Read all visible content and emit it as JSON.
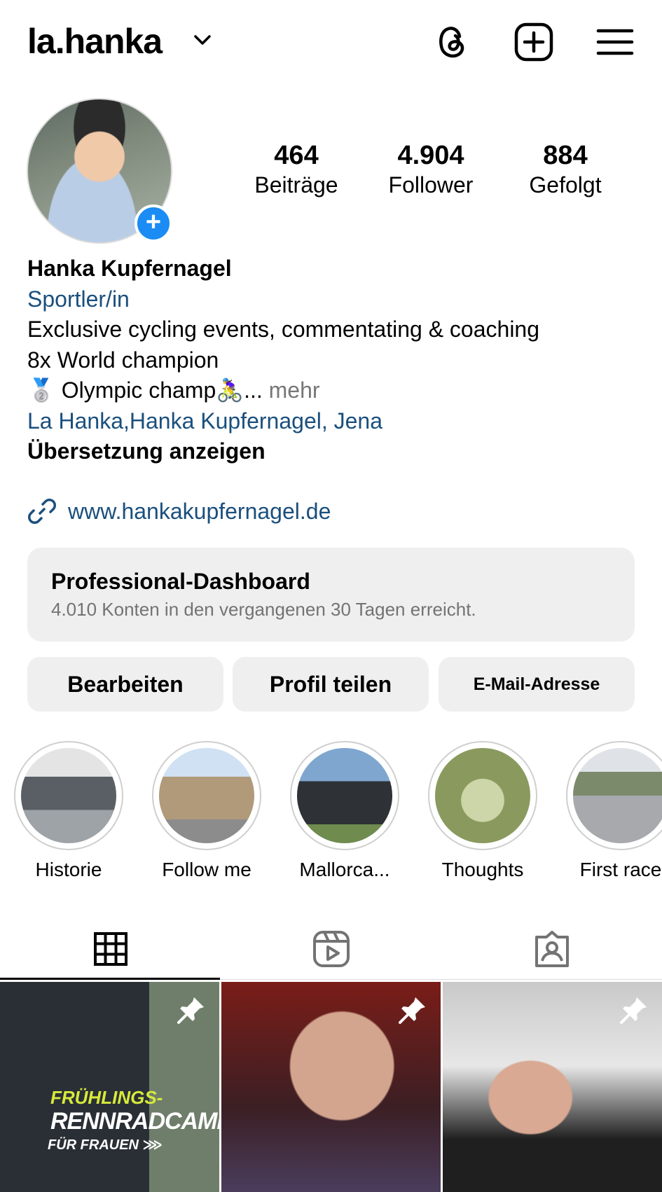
{
  "header": {
    "username": "la.hanka"
  },
  "stats": [
    {
      "value": "464",
      "label": "Beiträge"
    },
    {
      "value": "4.904",
      "label": "Follower"
    },
    {
      "value": "884",
      "label": "Gefolgt"
    }
  ],
  "bio": {
    "name": "Hanka Kupfernagel",
    "category": "Sportler/in",
    "line1": "Exclusive cycling events, commentating & coaching",
    "line2": "8x World champion",
    "line3": "🥈 Olympic champ🚴‍♀️...",
    "more": "mehr",
    "location": "La Hanka,Hanka Kupfernagel, Jena",
    "translate": "Übersetzung anzeigen",
    "website": "www.hankakupfernagel.de"
  },
  "dashboard": {
    "title": "Professional-Dashboard",
    "subtitle": "4.010 Konten in den vergangenen 30 Tagen erreicht."
  },
  "buttons": {
    "edit": "Bearbeiten",
    "share": "Profil teilen",
    "email": "E-Mail-Adresse"
  },
  "highlights": [
    {
      "label": "Historie",
      "color": "#8a8f96"
    },
    {
      "label": "Follow me",
      "color": "#9fb3c7"
    },
    {
      "label": "Mallorca...",
      "color": "#4b5a6b"
    },
    {
      "label": "Thoughts",
      "color": "#8a9a5e"
    },
    {
      "label": "First race",
      "color": "#a7a9ad"
    }
  ],
  "posts": {
    "post1_line1": "FRÜHLINGS-",
    "post1_line2": "RENNRADCAMP",
    "post1_line3": "FÜR FRAUEN ⋙"
  },
  "colors": {
    "accent_blue": "#1a8cf3",
    "link_blue": "#1a4f7d",
    "button_bg": "#efefef"
  }
}
